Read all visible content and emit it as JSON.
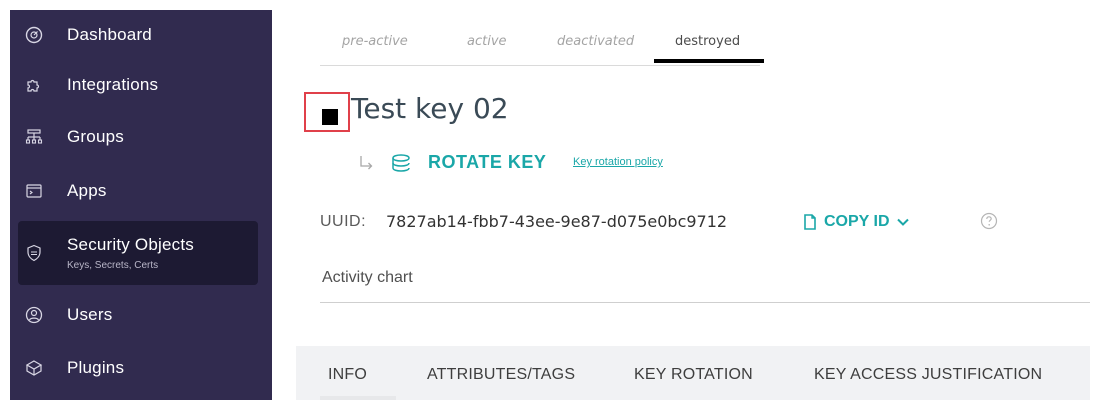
{
  "sidebar": {
    "items": [
      {
        "label": "Dashboard",
        "icon": "dashboard-icon"
      },
      {
        "label": "Integrations",
        "icon": "integrations-icon"
      },
      {
        "label": "Groups",
        "icon": "groups-icon"
      },
      {
        "label": "Apps",
        "icon": "apps-icon"
      },
      {
        "label": "Security Objects",
        "sublabel": "Keys, Secrets, Certs",
        "icon": "security-objects-icon",
        "active": true
      },
      {
        "label": "Users",
        "icon": "users-icon"
      },
      {
        "label": "Plugins",
        "icon": "plugins-icon"
      }
    ]
  },
  "state_tabs": {
    "items": [
      "pre-active",
      "active",
      "deactivated",
      "destroyed"
    ],
    "selected": "destroyed"
  },
  "key": {
    "title": "Test key 02",
    "rotate_label": "ROTATE KEY",
    "rotation_policy_link": "Key rotation policy",
    "uuid_label": "UUID:",
    "uuid_value": "7827ab14-fbb7-43ee-9e87-d075e0bc9712",
    "copy_label": "COPY ID"
  },
  "activity": {
    "label": "Activity chart"
  },
  "detail_tabs": {
    "items": [
      "INFO",
      "ATTRIBUTES/TAGS",
      "KEY ROTATION",
      "KEY ACCESS JUSTIFICATION"
    ],
    "selected": "INFO"
  },
  "colors": {
    "sidebar_bg": "#312b4f",
    "sidebar_active_bg": "#1d1a33",
    "accent": "#1aa7a8",
    "highlight_border": "#e0404a"
  }
}
